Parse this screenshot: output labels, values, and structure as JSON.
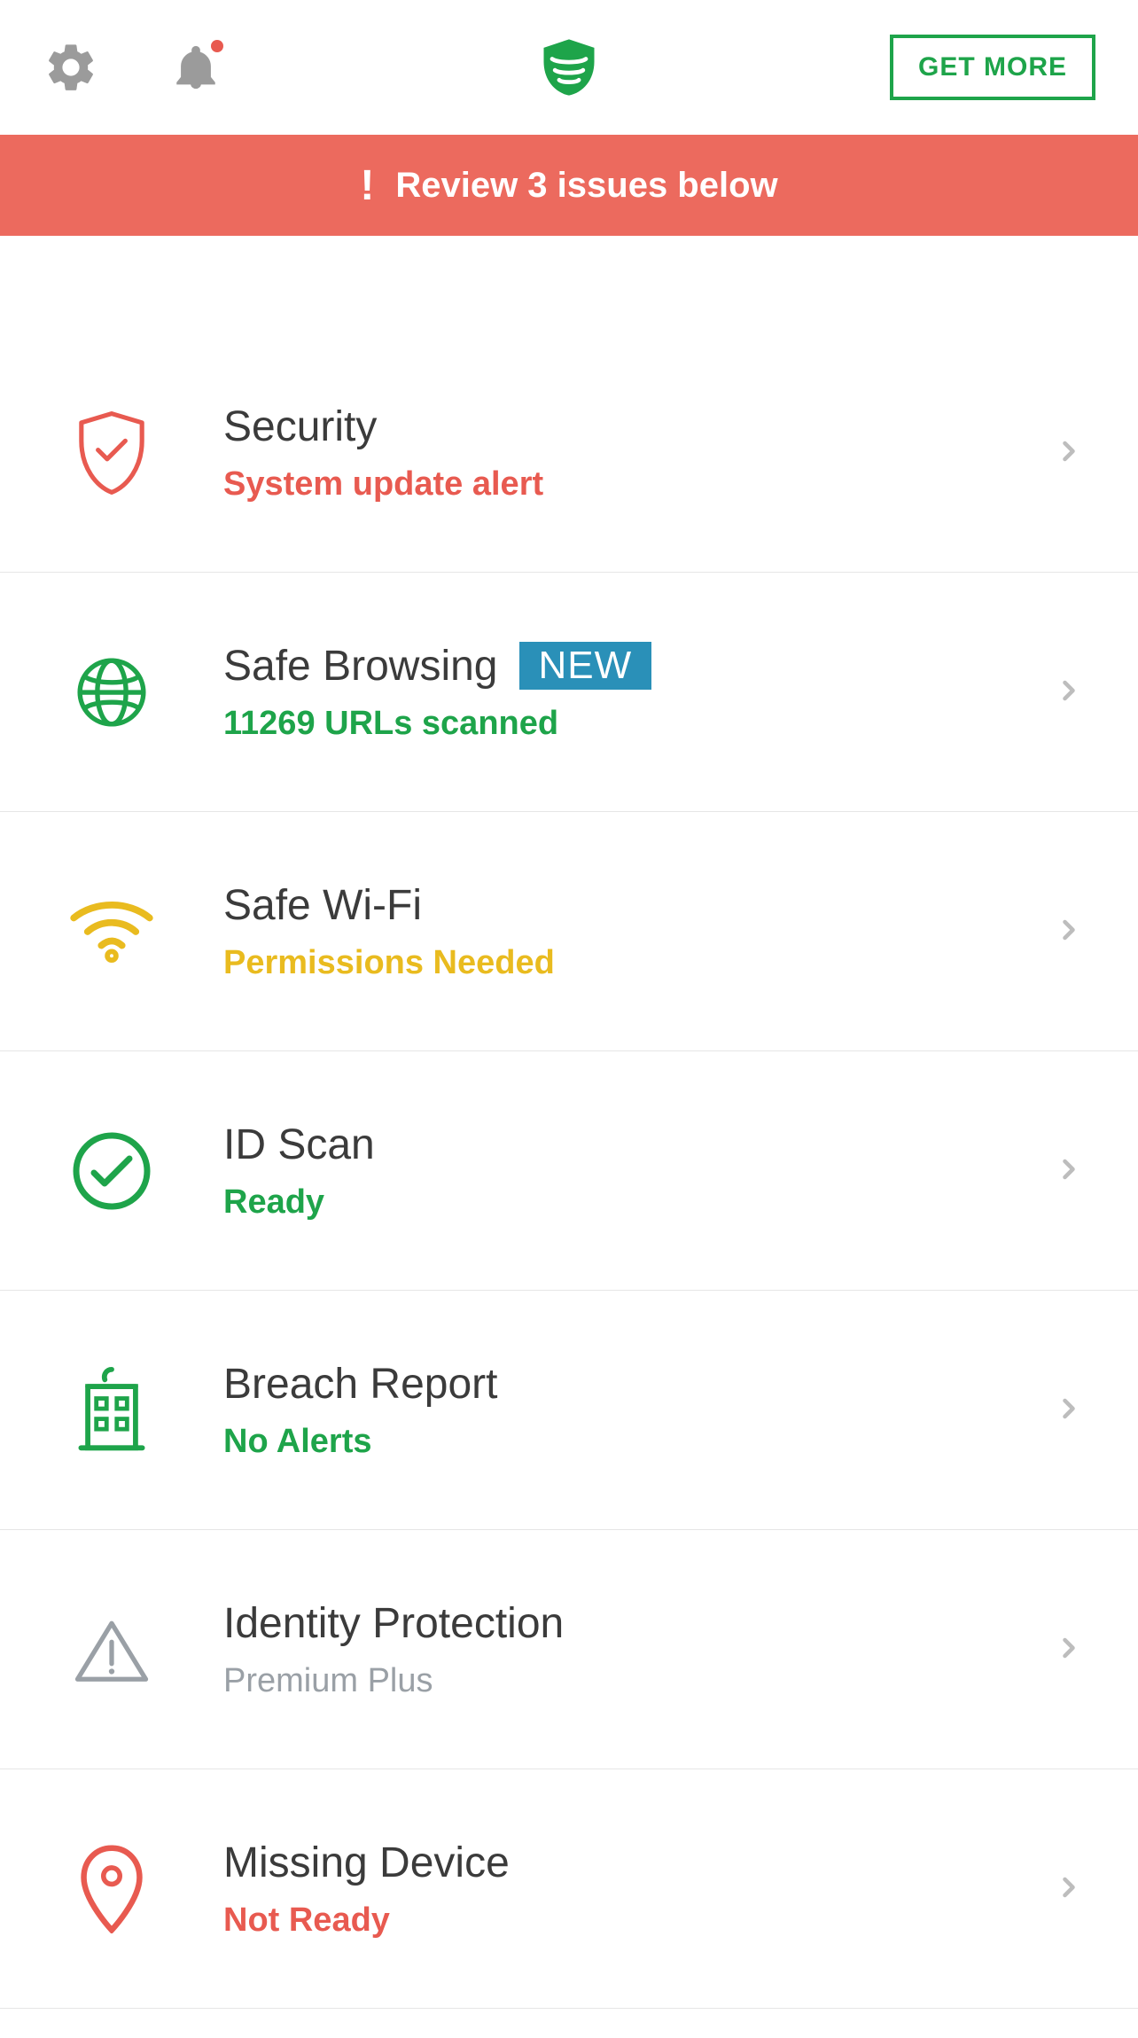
{
  "header": {
    "get_more_label": "GET MORE"
  },
  "alert": {
    "text": "Review 3 issues below"
  },
  "rows": [
    {
      "title": "Security",
      "subtitle": "System update alert",
      "sub_class": "sub-red",
      "icon": "shield-check-icon",
      "badge": null
    },
    {
      "title": "Safe Browsing",
      "subtitle": "11269 URLs scanned",
      "sub_class": "sub-green",
      "icon": "globe-icon",
      "badge": "NEW"
    },
    {
      "title": "Safe Wi-Fi",
      "subtitle": "Permissions Needed",
      "sub_class": "sub-yellow",
      "icon": "wifi-icon",
      "badge": null
    },
    {
      "title": "ID Scan",
      "subtitle": "Ready",
      "sub_class": "sub-green",
      "icon": "circle-check-icon",
      "badge": null
    },
    {
      "title": "Breach Report",
      "subtitle": "No Alerts",
      "sub_class": "sub-green",
      "icon": "building-icon",
      "badge": null
    },
    {
      "title": "Identity Protection",
      "subtitle": "Premium Plus",
      "sub_class": "sub-gray",
      "icon": "warning-triangle-icon",
      "badge": null
    },
    {
      "title": "Missing Device",
      "subtitle": "Not Ready",
      "sub_class": "sub-red",
      "icon": "map-pin-icon",
      "badge": null
    }
  ],
  "colors": {
    "green": "#1ea44a",
    "red": "#e85a50",
    "yellow": "#e9bb1f",
    "gray": "#9aa0a6",
    "banner": "#ec6a5e",
    "badge": "#2a90b8"
  }
}
